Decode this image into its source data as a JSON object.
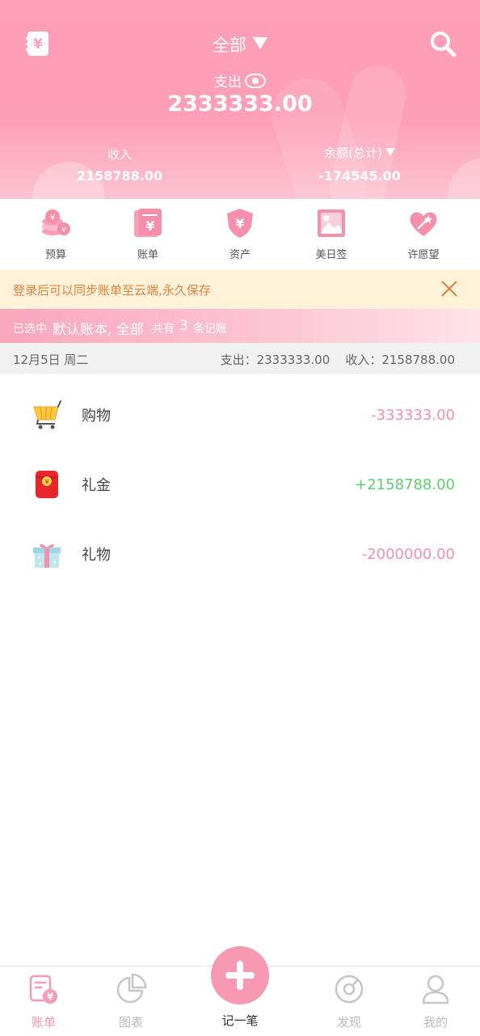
{
  "colors": {
    "brand": "#fd9fb6",
    "expense": "#f48fb1",
    "income": "#5fce6e",
    "notice_text": "#e0823f",
    "notice_bg": "#fff2d9"
  },
  "header": {
    "book_selector": "全部",
    "expense_label": "支出",
    "expense_value": "2333333.00",
    "income_label": "收入",
    "income_value": "2158788.00",
    "balance_label": "余额(总计)",
    "balance_value": "-174545.00",
    "left_icon": "wallet-icon",
    "right_icon": "search-icon"
  },
  "shortcuts": [
    {
      "label": "预算",
      "icon": "coins-icon"
    },
    {
      "label": "账单",
      "icon": "bill-icon"
    },
    {
      "label": "资产",
      "icon": "shield-yen-icon"
    },
    {
      "label": "美日签",
      "icon": "image-icon"
    },
    {
      "label": "许愿望",
      "icon": "heart-wand-icon"
    }
  ],
  "notice": {
    "text": "登录后可以同步账单至云端,永久保存",
    "icon": "close-icon"
  },
  "selection": {
    "prefix": "已选中",
    "books": "默认账本, 全部",
    "count_prefix": "共有",
    "count": "3",
    "count_suffix": "条记账"
  },
  "day": {
    "date": "12月5日 周二",
    "summary": "支出：2333333.00    收入：2158788.00"
  },
  "records": [
    {
      "name": "购物",
      "amount": "-333333.00",
      "type": "expense",
      "icon": "shopping-cart-icon"
    },
    {
      "name": "礼金",
      "amount": "+2158788.00",
      "type": "income",
      "icon": "red-envelope-icon"
    },
    {
      "name": "礼物",
      "amount": "-2000000.00",
      "type": "expense",
      "icon": "gift-icon"
    }
  ],
  "tabbar": {
    "tabs": [
      {
        "label": "账单",
        "icon": "bill-tab-icon",
        "active": true
      },
      {
        "label": "图表",
        "icon": "pie-chart-icon",
        "active": false
      },
      {
        "label": "记一笔",
        "icon": "plus-icon",
        "active": false
      },
      {
        "label": "发现",
        "icon": "compass-icon",
        "active": false
      },
      {
        "label": "我的",
        "icon": "profile-icon",
        "active": false
      }
    ]
  }
}
